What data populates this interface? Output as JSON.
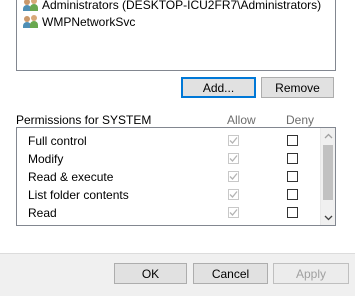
{
  "groups": [
    {
      "label": "Administrators (DESKTOP-ICU2FR7\\Administrators)",
      "icon": "users-icon"
    },
    {
      "label": "WMPNetworkSvc",
      "icon": "users-icon"
    }
  ],
  "buttons": {
    "add": "Add...",
    "remove": "Remove",
    "ok": "OK",
    "cancel": "Cancel",
    "apply": "Apply"
  },
  "permissions": {
    "title": "Permissions for SYSTEM",
    "allow_header": "Allow",
    "deny_header": "Deny",
    "rows": [
      {
        "name": "Full control",
        "allow": true,
        "deny": false
      },
      {
        "name": "Modify",
        "allow": true,
        "deny": false
      },
      {
        "name": "Read & execute",
        "allow": true,
        "deny": false
      },
      {
        "name": "List folder contents",
        "allow": true,
        "deny": false
      },
      {
        "name": "Read",
        "allow": true,
        "deny": false
      },
      {
        "name": "",
        "allow": true,
        "deny": false
      }
    ]
  },
  "colors": {
    "focus_border": "#0078d7",
    "disabled_text": "#a0a0a0"
  }
}
